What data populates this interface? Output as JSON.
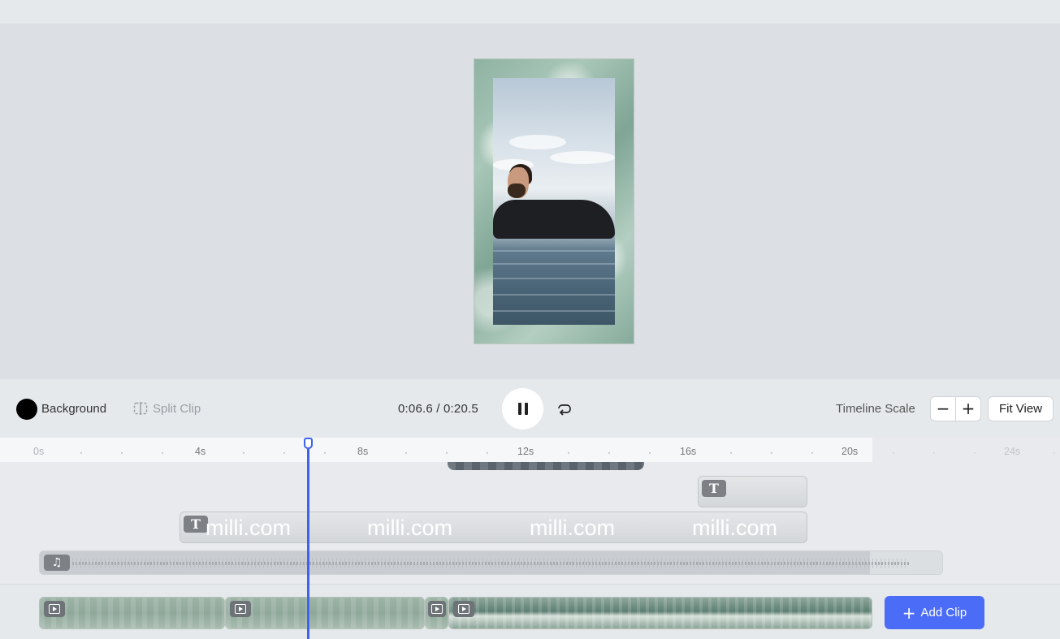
{
  "toolbar": {
    "background_label": "Background",
    "background_color": "#000000",
    "split_label": "Split Clip",
    "time_display": "0:06.6 / 0:20.5",
    "scale_label": "Timeline Scale",
    "zoom_out": "−",
    "zoom_in": "+",
    "fit_view_label": "Fit View"
  },
  "ruler": {
    "labels": [
      "0s",
      "4s",
      "8s",
      "12s",
      "16s",
      "20s",
      "24s"
    ]
  },
  "tracks": {
    "watermark_text": "milli.com",
    "text_icon": "T",
    "audio_icon": "♫"
  },
  "actions": {
    "add_clip_label": "Add Clip",
    "add_clip_icon": "+"
  },
  "colors": {
    "accent": "#4a6cf7",
    "playhead": "#3d63f0"
  }
}
